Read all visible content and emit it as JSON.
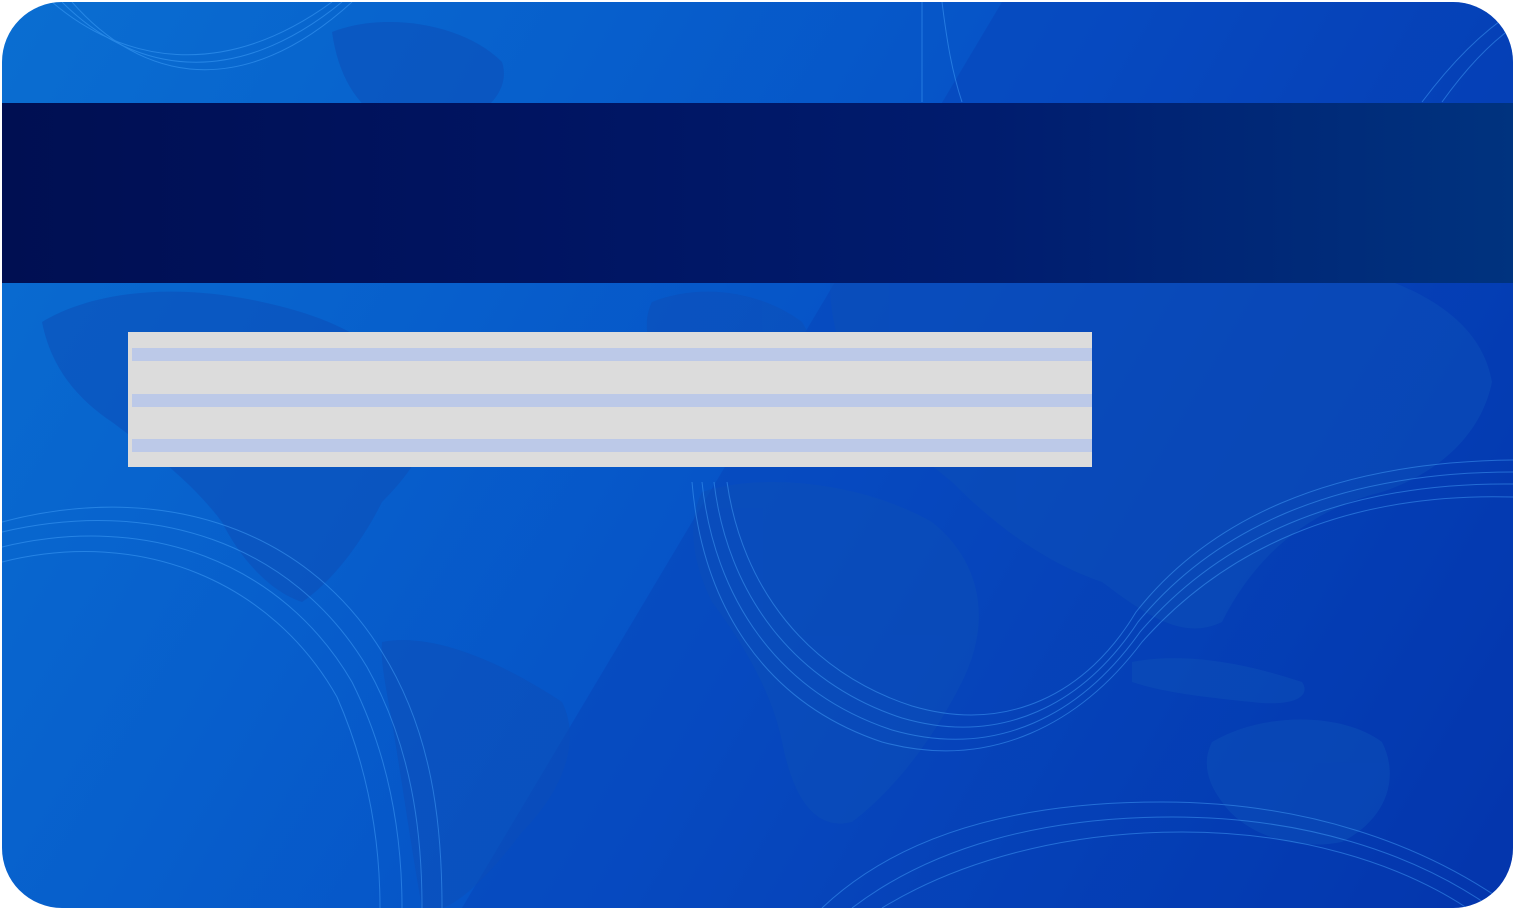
{
  "card": {
    "side": "back",
    "background_motif": "world-map",
    "colors": {
      "card_light": "#0a6ed1",
      "card_dark": "#0232a8",
      "magnetic_stripe": "#001461",
      "signature_panel": "#dcdcdc",
      "signature_lines": "#bcc9e8"
    },
    "signature_panel": {
      "line_count": 3
    }
  }
}
